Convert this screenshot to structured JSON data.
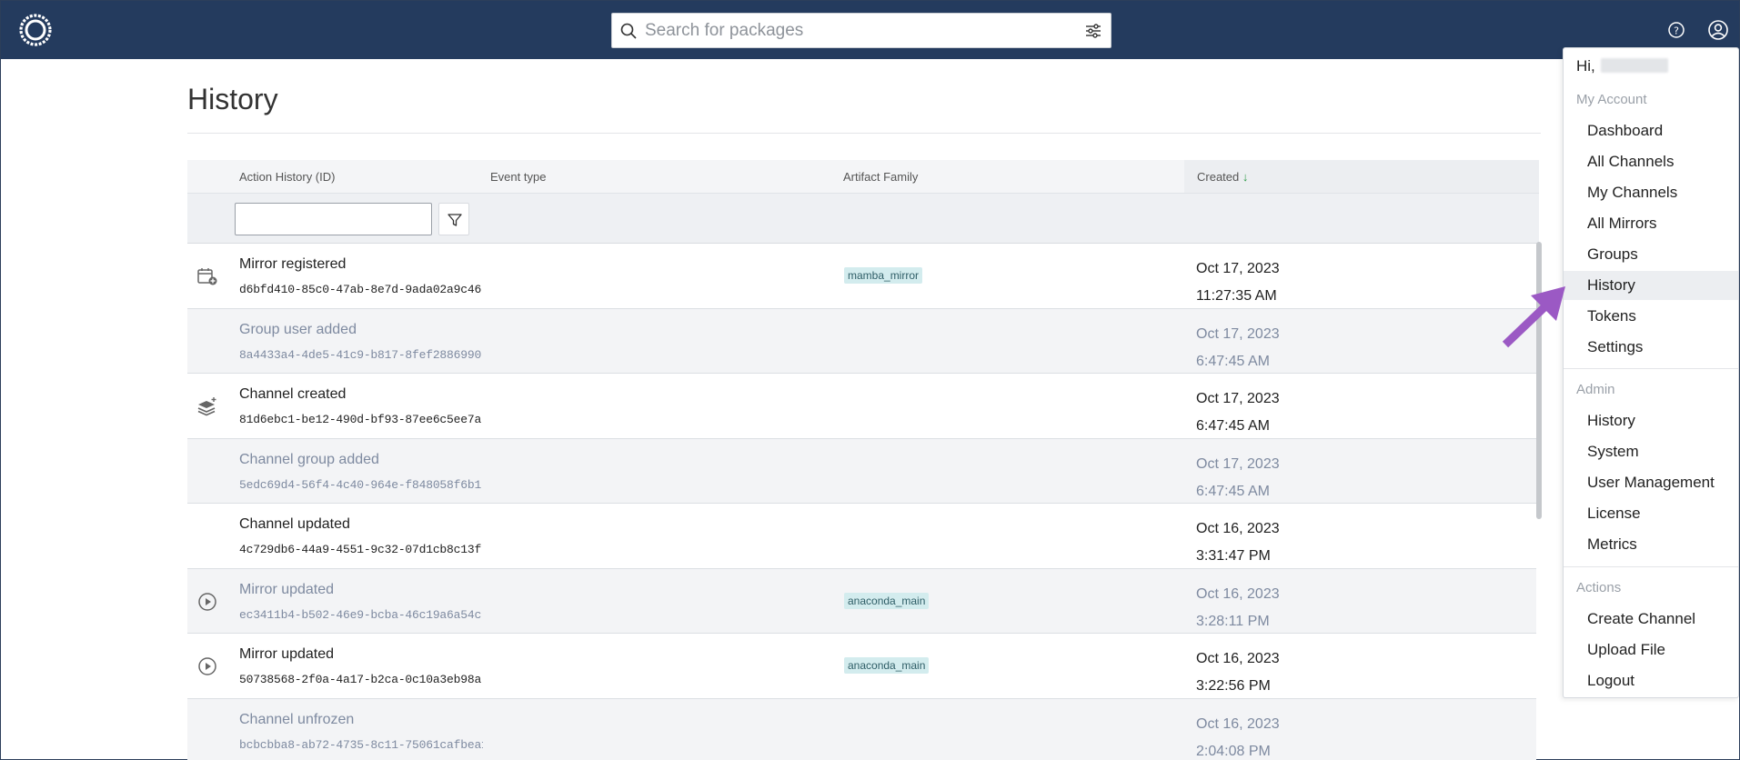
{
  "search": {
    "placeholder": "Search for packages"
  },
  "page": {
    "title": "History"
  },
  "table": {
    "columns": [
      "Action History (ID)",
      "Event type",
      "Artifact Family",
      "Created"
    ],
    "sort_arrow": "↓",
    "rows": [
      {
        "name": "Mirror registered",
        "id": "d6bfd410-85c0-47ab-8e7d-9ada02a9c46",
        "tag": "mamba_mirror",
        "date": "Oct 17, 2023",
        "time": "11:27:35 AM",
        "icon": "calendar-add-icon"
      },
      {
        "name": "Group user added",
        "id": "8a4433a4-4de5-41c9-b817-8fef2886990",
        "tag": "",
        "date": "Oct 17, 2023",
        "time": "6:47:45 AM",
        "icon": ""
      },
      {
        "name": "Channel created",
        "id": "81d6ebc1-be12-490d-bf93-87ee6c5ee7a",
        "tag": "",
        "date": "Oct 17, 2023",
        "time": "6:47:45 AM",
        "icon": "layers-plus-icon"
      },
      {
        "name": "Channel group added",
        "id": "5edc69d4-56f4-4c40-964e-f848058f6b1",
        "tag": "",
        "date": "Oct 17, 2023",
        "time": "6:47:45 AM",
        "icon": ""
      },
      {
        "name": "Channel updated",
        "id": "4c729db6-44a9-4551-9c32-07d1cb8c13f",
        "tag": "",
        "date": "Oct 16, 2023",
        "time": "3:31:47 PM",
        "icon": ""
      },
      {
        "name": "Mirror updated",
        "id": "ec3411b4-b502-46e9-bcba-46c19a6a54c",
        "tag": "anaconda_main",
        "date": "Oct 16, 2023",
        "time": "3:28:11 PM",
        "icon": "play-circle-icon"
      },
      {
        "name": "Mirror updated",
        "id": "50738568-2f0a-4a17-b2ca-0c10a3eb98a",
        "tag": "anaconda_main",
        "date": "Oct 16, 2023",
        "time": "3:22:56 PM",
        "icon": "play-circle-icon"
      },
      {
        "name": "Channel unfrozen",
        "id": "bcbcbba8-ab72-4735-8c11-75061cafbea1",
        "tag": "",
        "date": "Oct 16, 2023",
        "time": "2:04:08 PM",
        "icon": ""
      }
    ]
  },
  "menu": {
    "greeting": "Hi,",
    "my_account_label": "My Account",
    "my_account": [
      "Dashboard",
      "All Channels",
      "My Channels",
      "All Mirrors",
      "Groups",
      "History",
      "Tokens",
      "Settings"
    ],
    "admin_label": "Admin",
    "admin": [
      "History",
      "System",
      "User Management",
      "License",
      "Metrics"
    ],
    "actions_label": "Actions",
    "actions": [
      "Create Channel",
      "Upload File",
      "Logout"
    ]
  },
  "colors": {
    "topbar": "#243b5e",
    "tag_bg": "#d3ecee",
    "arrow": "#9b59c4",
    "sort": "#2e9b47"
  }
}
